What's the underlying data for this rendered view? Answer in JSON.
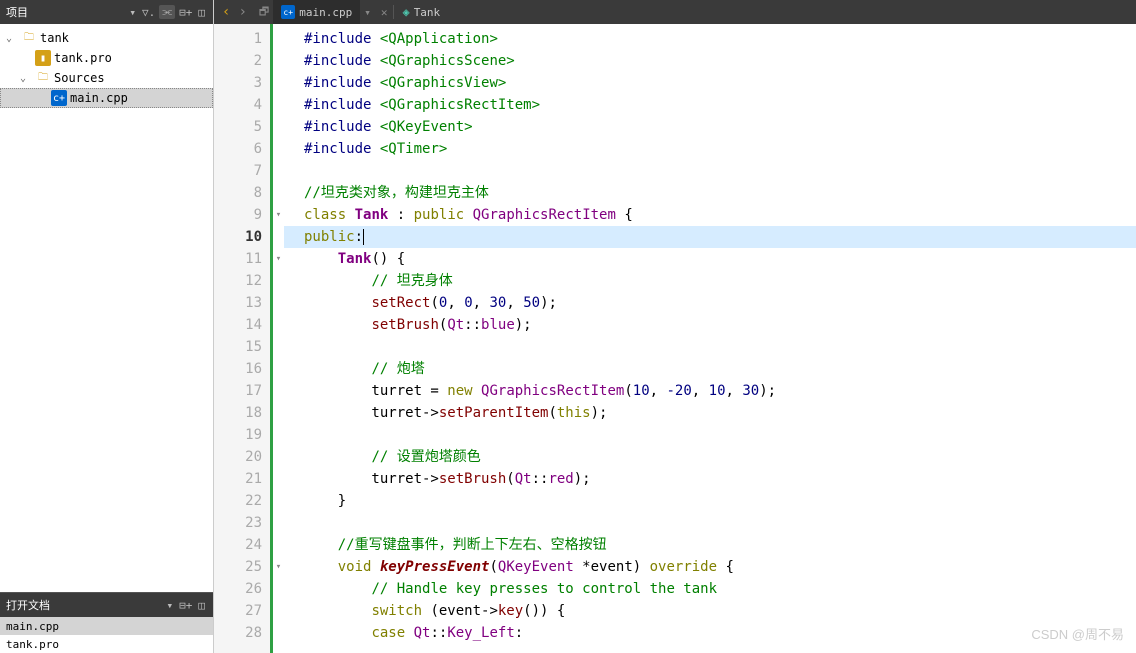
{
  "sidebar": {
    "project_title": "项目",
    "tree": {
      "root": "tank",
      "pro": "tank.pro",
      "sources": "Sources",
      "main": "main.cpp"
    },
    "docs_title": "打开文档",
    "docs": [
      "main.cpp",
      "tank.pro"
    ]
  },
  "tabbar": {
    "file": "main.cpp",
    "symbol": "Tank"
  },
  "editor": {
    "current_line": 10,
    "fold_lines": [
      9,
      11,
      25
    ],
    "lines": [
      {
        "n": 1,
        "tokens": [
          [
            "pp",
            "#include"
          ],
          [
            "op",
            " "
          ],
          [
            "inc",
            "<QApplication>"
          ]
        ]
      },
      {
        "n": 2,
        "tokens": [
          [
            "pp",
            "#include"
          ],
          [
            "op",
            " "
          ],
          [
            "inc",
            "<QGraphicsScene>"
          ]
        ]
      },
      {
        "n": 3,
        "tokens": [
          [
            "pp",
            "#include"
          ],
          [
            "op",
            " "
          ],
          [
            "inc",
            "<QGraphicsView>"
          ]
        ]
      },
      {
        "n": 4,
        "tokens": [
          [
            "pp",
            "#include"
          ],
          [
            "op",
            " "
          ],
          [
            "inc",
            "<QGraphicsRectItem>"
          ]
        ]
      },
      {
        "n": 5,
        "tokens": [
          [
            "pp",
            "#include"
          ],
          [
            "op",
            " "
          ],
          [
            "inc",
            "<QKeyEvent>"
          ]
        ]
      },
      {
        "n": 6,
        "tokens": [
          [
            "pp",
            "#include"
          ],
          [
            "op",
            " "
          ],
          [
            "inc",
            "<QTimer>"
          ]
        ]
      },
      {
        "n": 7,
        "tokens": []
      },
      {
        "n": 8,
        "tokens": [
          [
            "cm",
            "//坦克类对象，构建坦克主体"
          ]
        ]
      },
      {
        "n": 9,
        "tokens": [
          [
            "kw",
            "class"
          ],
          [
            "op",
            " "
          ],
          [
            "cls",
            "Tank"
          ],
          [
            "op",
            " : "
          ],
          [
            "kw",
            "public"
          ],
          [
            "op",
            " "
          ],
          [
            "ty",
            "QGraphicsRectItem"
          ],
          [
            "op",
            " {"
          ]
        ]
      },
      {
        "n": 10,
        "tokens": [
          [
            "kw",
            "public"
          ],
          [
            "op",
            ":"
          ]
        ]
      },
      {
        "n": 11,
        "tokens": [
          [
            "op",
            "    "
          ],
          [
            "cls",
            "Tank"
          ],
          [
            "op",
            "() {"
          ]
        ]
      },
      {
        "n": 12,
        "tokens": [
          [
            "op",
            "        "
          ],
          [
            "cm",
            "// 坦克身体"
          ]
        ]
      },
      {
        "n": 13,
        "tokens": [
          [
            "op",
            "        "
          ],
          [
            "fn2",
            "setRect"
          ],
          [
            "op",
            "("
          ],
          [
            "num",
            "0"
          ],
          [
            "op",
            ", "
          ],
          [
            "num",
            "0"
          ],
          [
            "op",
            ", "
          ],
          [
            "num",
            "30"
          ],
          [
            "op",
            ", "
          ],
          [
            "num",
            "50"
          ],
          [
            "op",
            ");"
          ]
        ]
      },
      {
        "n": 14,
        "tokens": [
          [
            "op",
            "        "
          ],
          [
            "fn2",
            "setBrush"
          ],
          [
            "op",
            "("
          ],
          [
            "ns",
            "Qt"
          ],
          [
            "op",
            "::"
          ],
          [
            "ty",
            "blue"
          ],
          [
            "op",
            ");"
          ]
        ]
      },
      {
        "n": 15,
        "tokens": []
      },
      {
        "n": 16,
        "tokens": [
          [
            "op",
            "        "
          ],
          [
            "cm",
            "// 炮塔"
          ]
        ]
      },
      {
        "n": 17,
        "tokens": [
          [
            "op",
            "        turret = "
          ],
          [
            "kw",
            "new"
          ],
          [
            "op",
            " "
          ],
          [
            "ty",
            "QGraphicsRectItem"
          ],
          [
            "op",
            "("
          ],
          [
            "num",
            "10"
          ],
          [
            "op",
            ", "
          ],
          [
            "num",
            "-20"
          ],
          [
            "op",
            ", "
          ],
          [
            "num",
            "10"
          ],
          [
            "op",
            ", "
          ],
          [
            "num",
            "30"
          ],
          [
            "op",
            ");"
          ]
        ]
      },
      {
        "n": 18,
        "tokens": [
          [
            "op",
            "        turret->"
          ],
          [
            "fn2",
            "setParentItem"
          ],
          [
            "op",
            "("
          ],
          [
            "kw",
            "this"
          ],
          [
            "op",
            ");"
          ]
        ]
      },
      {
        "n": 19,
        "tokens": []
      },
      {
        "n": 20,
        "tokens": [
          [
            "op",
            "        "
          ],
          [
            "cm",
            "// 设置炮塔颜色"
          ]
        ]
      },
      {
        "n": 21,
        "tokens": [
          [
            "op",
            "        turret->"
          ],
          [
            "fn2",
            "setBrush"
          ],
          [
            "op",
            "("
          ],
          [
            "ns",
            "Qt"
          ],
          [
            "op",
            "::"
          ],
          [
            "ty",
            "red"
          ],
          [
            "op",
            ");"
          ]
        ]
      },
      {
        "n": 22,
        "tokens": [
          [
            "op",
            "    }"
          ]
        ]
      },
      {
        "n": 23,
        "tokens": []
      },
      {
        "n": 24,
        "tokens": [
          [
            "op",
            "    "
          ],
          [
            "cm",
            "//重写键盘事件，判断上下左右、空格按钮"
          ]
        ]
      },
      {
        "n": 25,
        "tokens": [
          [
            "op",
            "    "
          ],
          [
            "kw",
            "void"
          ],
          [
            "op",
            " "
          ],
          [
            "fn",
            "keyPressEvent"
          ],
          [
            "op",
            "("
          ],
          [
            "ty",
            "QKeyEvent"
          ],
          [
            "op",
            " *event) "
          ],
          [
            "kw",
            "override"
          ],
          [
            "op",
            " {"
          ]
        ]
      },
      {
        "n": 26,
        "tokens": [
          [
            "op",
            "        "
          ],
          [
            "cm",
            "// Handle key presses to control the tank"
          ]
        ]
      },
      {
        "n": 27,
        "tokens": [
          [
            "op",
            "        "
          ],
          [
            "kw",
            "switch"
          ],
          [
            "op",
            " (event->"
          ],
          [
            "fn2",
            "key"
          ],
          [
            "op",
            "()) {"
          ]
        ]
      },
      {
        "n": 28,
        "tokens": [
          [
            "op",
            "        "
          ],
          [
            "kw",
            "case"
          ],
          [
            "op",
            " "
          ],
          [
            "ns",
            "Qt"
          ],
          [
            "op",
            "::"
          ],
          [
            "ty",
            "Key_Left"
          ],
          [
            "op",
            ":"
          ]
        ]
      }
    ]
  },
  "watermark": "CSDN @周不易"
}
